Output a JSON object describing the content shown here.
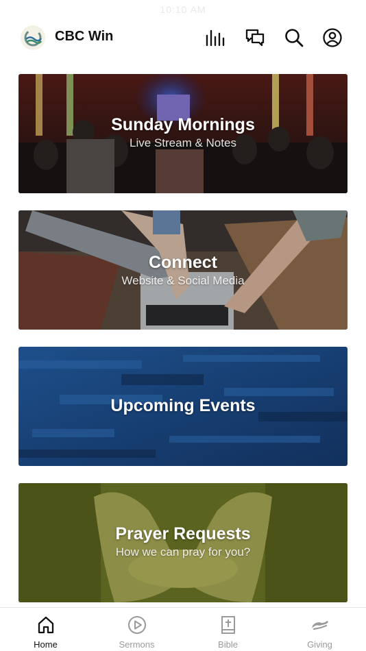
{
  "status_bar": {
    "time": "10:10 AM"
  },
  "header": {
    "app_name": "CBC Win",
    "icons": [
      "audio-bars-icon",
      "chat-bubbles-icon",
      "search-icon",
      "account-icon"
    ]
  },
  "cards": [
    {
      "title": "Sunday Mornings",
      "subtitle": "Live Stream & Notes"
    },
    {
      "title": "Connect",
      "subtitle": "Website & Social Media"
    },
    {
      "title": "Upcoming Events",
      "subtitle": ""
    },
    {
      "title": "Prayer Requests",
      "subtitle": "How we can pray for you?"
    }
  ],
  "tab_bar": {
    "active": "Home",
    "tabs": [
      {
        "label": "Home",
        "icon": "home-icon"
      },
      {
        "label": "Sermons",
        "icon": "play-circle-icon"
      },
      {
        "label": "Bible",
        "icon": "bible-icon"
      },
      {
        "label": "Giving",
        "icon": "giving-hand-icon"
      }
    ]
  },
  "colors": {
    "events_blue": "#1c4a82",
    "prayer_olive": "#6f7a2a",
    "tab_inactive": "#9a9a9a",
    "tab_active": "#111111"
  }
}
